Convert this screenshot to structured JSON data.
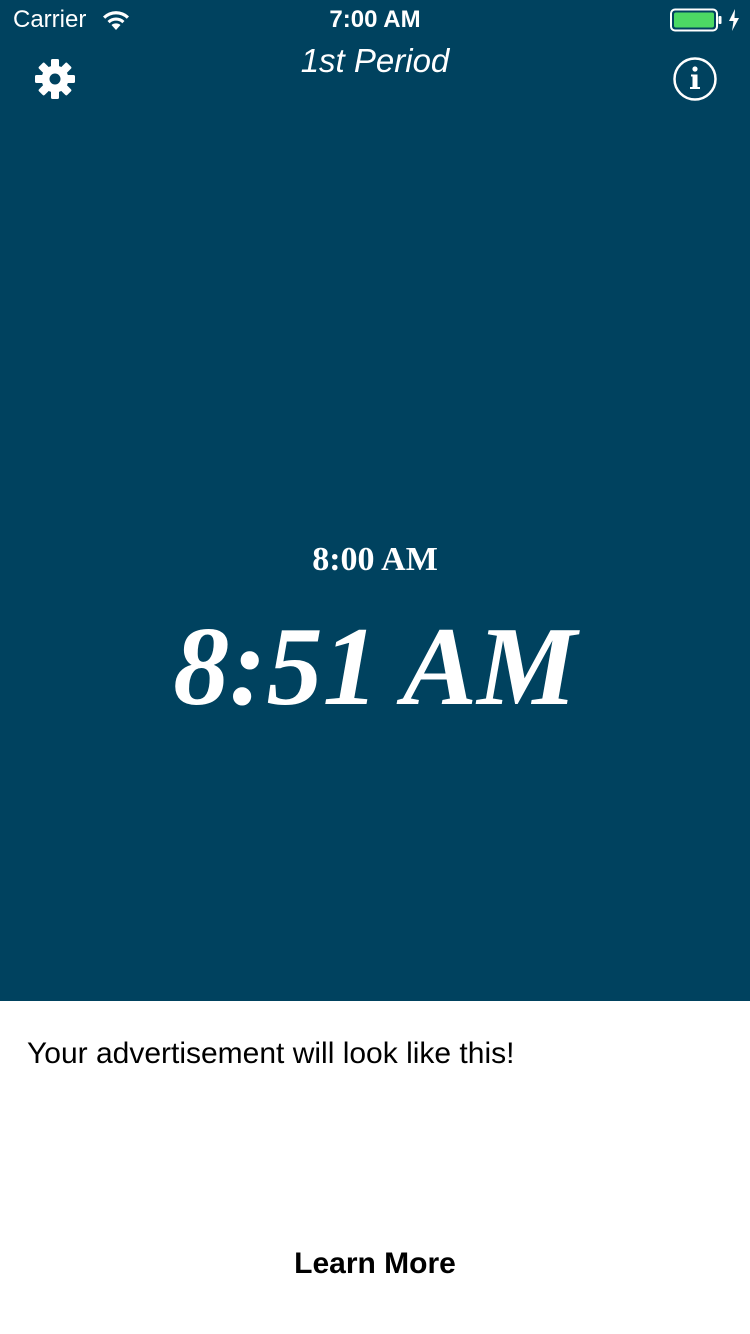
{
  "status_bar": {
    "carrier": "Carrier",
    "time": "7:00 AM",
    "battery_color": "#4cd964",
    "icons": [
      "wifi-icon",
      "battery-icon",
      "charging-icon"
    ]
  },
  "nav": {
    "title": "1st Period",
    "left_icon": "gear-icon",
    "right_icon": "info-icon"
  },
  "main": {
    "background_color": "#00425f",
    "start_time": "8:00 AM",
    "current_time": "8:51 AM"
  },
  "ad": {
    "text": "Your advertisement will look like this!",
    "cta_label": "Learn More"
  }
}
